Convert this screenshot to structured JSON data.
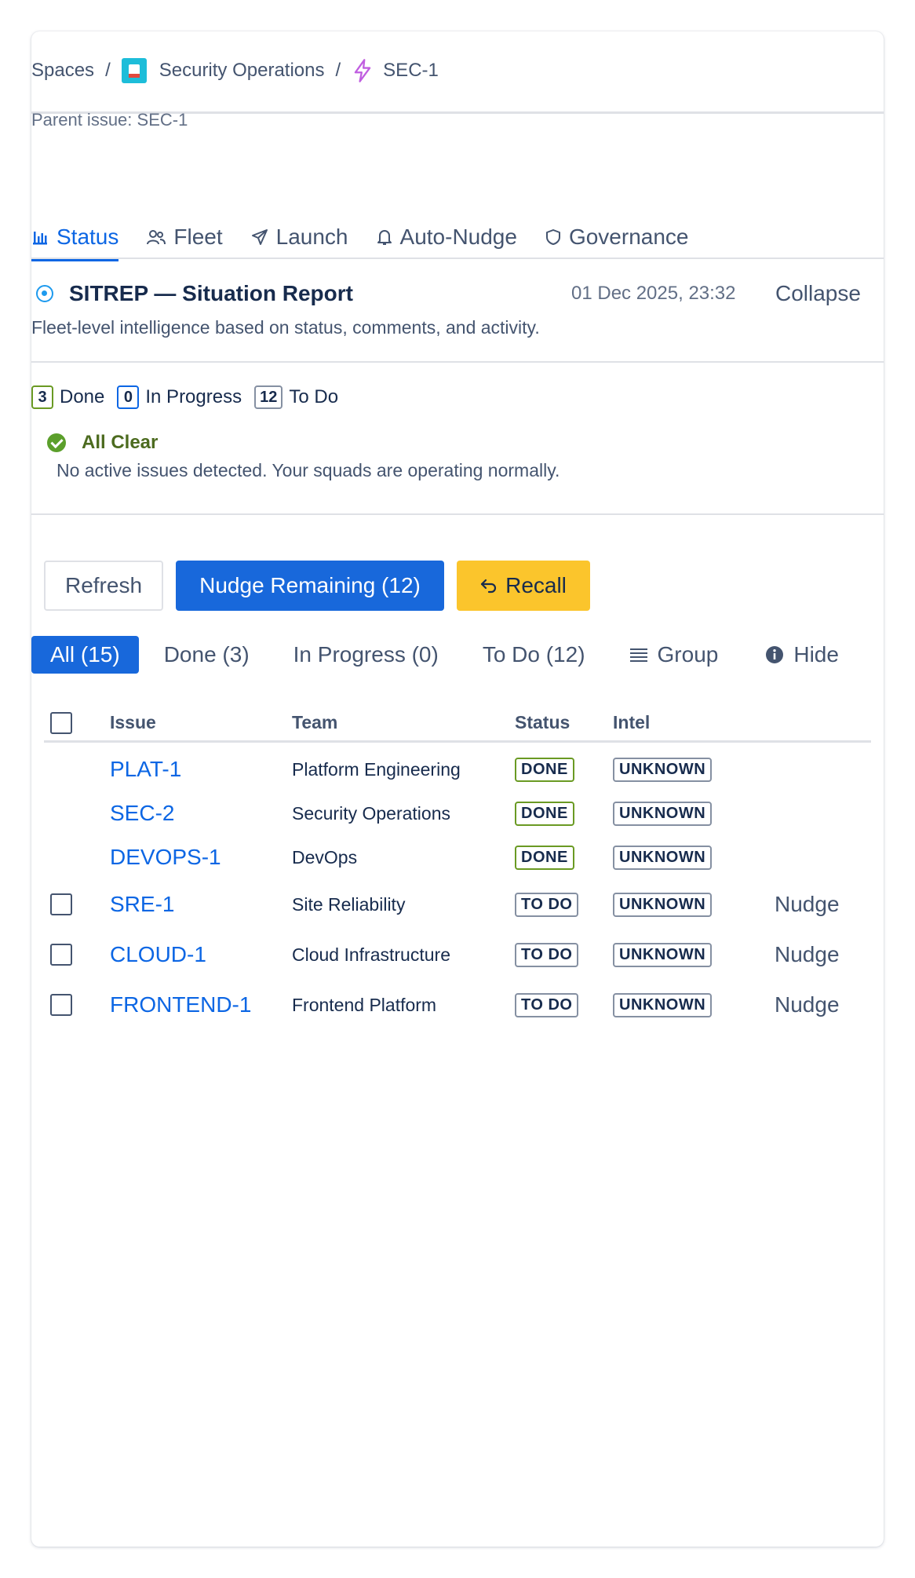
{
  "breadcrumb": {
    "spaces": "Spaces",
    "project": "Security Operations",
    "issue": "SEC-1",
    "separator": "/"
  },
  "parent_issue": "Parent issue: SEC-1",
  "tabs": [
    {
      "label": "Status",
      "icon": "bar-chart-icon",
      "active": true
    },
    {
      "label": "Fleet",
      "icon": "people-icon"
    },
    {
      "label": "Launch",
      "icon": "send-icon"
    },
    {
      "label": "Auto-Nudge",
      "icon": "bell-icon"
    },
    {
      "label": "Governance",
      "icon": "shield-icon"
    }
  ],
  "sitrep": {
    "title": "SITREP — Situation Report",
    "date": "01 Dec 2025, 23:32",
    "collapse_label": "Collapse",
    "subtitle": "Fleet-level intelligence based on status, comments, and activity."
  },
  "counters": {
    "done_count": "3",
    "done_label": "Done",
    "progress_count": "0",
    "progress_label": "In Progress",
    "todo_count": "12",
    "todo_label": "To Do"
  },
  "all_clear": {
    "title": "All Clear",
    "text": "No active issues detected. Your squads are operating normally."
  },
  "actions": {
    "refresh": "Refresh",
    "nudge_remaining": "Nudge Remaining (12)",
    "recall": "Recall"
  },
  "filters": {
    "all": "All (15)",
    "done": "Done (3)",
    "in_progress": "In Progress (0)",
    "todo": "To Do (12)",
    "group": "Group",
    "hide": "Hide"
  },
  "table": {
    "headers": {
      "issue": "Issue",
      "team": "Team",
      "status": "Status",
      "intel": "Intel"
    },
    "rows": [
      {
        "issue": "PLAT-1",
        "team": "Platform Engineering",
        "status": "DONE",
        "intel": "UNKNOWN",
        "action": ""
      },
      {
        "issue": "SEC-2",
        "team": "Security Operations",
        "status": "DONE",
        "intel": "UNKNOWN",
        "action": ""
      },
      {
        "issue": "DEVOPS-1",
        "team": "DevOps",
        "status": "DONE",
        "intel": "UNKNOWN",
        "action": ""
      },
      {
        "issue": "SRE-1",
        "team": "Site Reliability",
        "status": "TO DO",
        "intel": "UNKNOWN",
        "action": "Nudge"
      },
      {
        "issue": "CLOUD-1",
        "team": "Cloud Infrastructure",
        "status": "TO DO",
        "intel": "UNKNOWN",
        "action": "Nudge"
      },
      {
        "issue": "FRONTEND-1",
        "team": "Frontend Platform",
        "status": "TO DO",
        "intel": "UNKNOWN",
        "action": "Nudge"
      }
    ]
  },
  "colors": {
    "primary": "#1868db",
    "link": "#0c66e4",
    "recall": "#fbc52c",
    "success": "#5b9f2b",
    "done_border": "#6a9a23"
  }
}
